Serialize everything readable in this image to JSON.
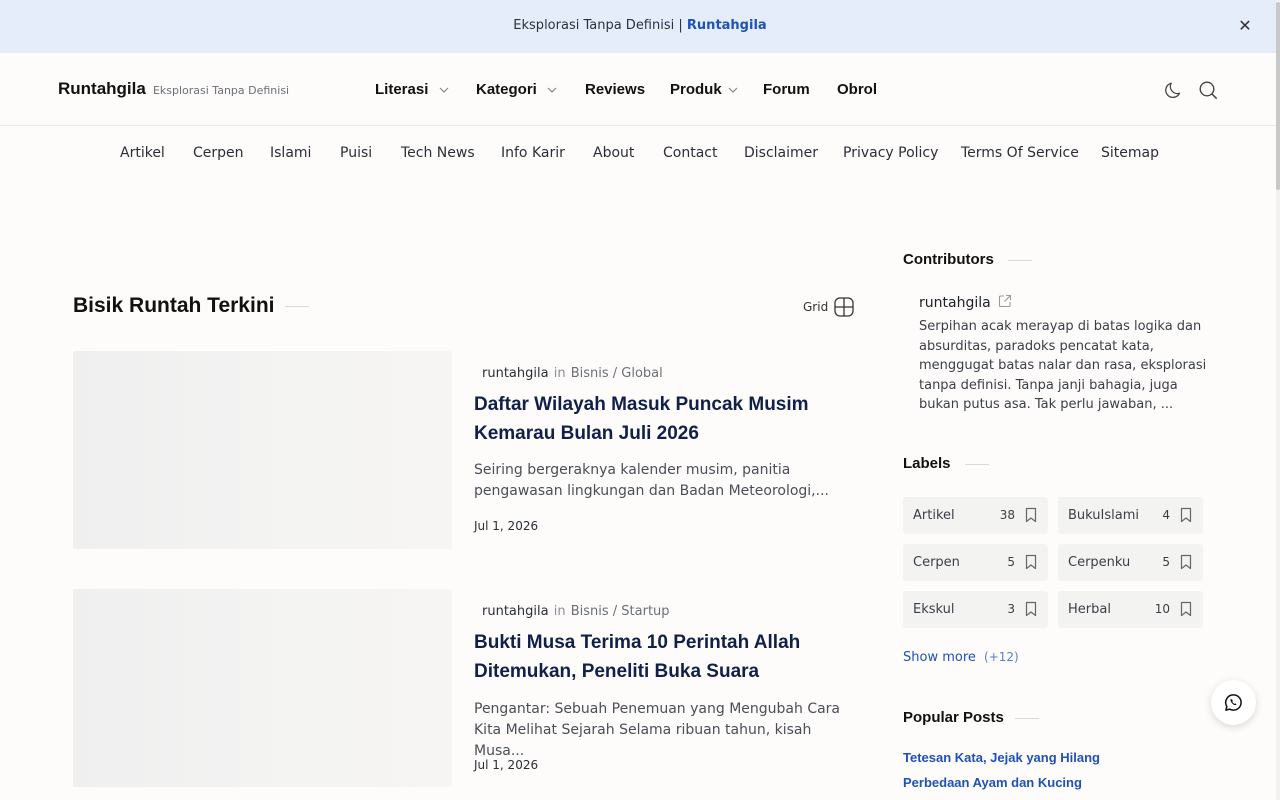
{
  "announcement": {
    "text": "Eksplorasi Tanpa Definisi",
    "separator": "|",
    "link": "Runtahgila",
    "close_icon": "close-icon"
  },
  "header": {
    "brand_name": "Runtahgila",
    "brand_tagline": "Eksplorasi Tanpa Definisi",
    "nav": [
      {
        "label": "Literasi",
        "has_dropdown": true
      },
      {
        "label": "Kategori",
        "has_dropdown": true
      },
      {
        "label": "Reviews",
        "has_dropdown": false
      },
      {
        "label": "Produk",
        "has_dropdown": true
      },
      {
        "label": "Forum",
        "has_dropdown": false
      },
      {
        "label": "Obrol",
        "has_dropdown": false
      }
    ],
    "icons": [
      "moon-icon",
      "search-icon"
    ]
  },
  "subnav": [
    "Artikel",
    "Cerpen",
    "Islami",
    "Puisi",
    "Tech News",
    "Info Karir",
    "About",
    "Contact",
    "Disclaimer",
    "Privacy Policy",
    "Terms Of Service",
    "Sitemap"
  ],
  "main": {
    "section_title": "Bisik Runtah Terkini",
    "view_toggle": "Grid",
    "posts": [
      {
        "author": "runtahgila",
        "in": "in",
        "category": "Bisnis / Global",
        "title": "Daftar Wilayah Masuk Puncak Musim Kemarau Bulan Juli 2026",
        "excerpt": "Seiring bergeraknya kalender musim, panitia pengawasan lingkungan dan Badan Meteorologi,...",
        "date": "Jul 1, 2026"
      },
      {
        "author": "runtahgila",
        "in": "in",
        "category": "Bisnis / Startup",
        "title": "Bukti Musa Terima 10 Perintah Allah Ditemukan, Peneliti Buka Suara",
        "excerpt": "Pengantar: Sebuah Penemuan yang Mengubah Cara Kita Melihat Sejarah Selama ribuan tahun, kisah Musa...",
        "date": "Jul 1, 2026"
      }
    ]
  },
  "sidebar": {
    "contributors_title": "Contributors",
    "contributor_name": "runtahgila",
    "contributor_bio": "Serpihan acak merayap di batas logika dan absurditas, paradoks pencatat kata, menggugat batas nalar dan rasa, eksplorasi tanpa definisi. Tanpa janji bahagia, juga bukan putus asa. Tak perlu jawaban, ...",
    "labels_title": "Labels",
    "labels": [
      {
        "name": "Artikel",
        "count": "38"
      },
      {
        "name": "BukuIslami",
        "count": "4"
      },
      {
        "name": "Cerpen",
        "count": "5"
      },
      {
        "name": "Cerpenku",
        "count": "5"
      },
      {
        "name": "Ekskul",
        "count": "3"
      },
      {
        "name": "Herbal",
        "count": "10"
      }
    ],
    "show_more": "Show more",
    "show_more_count": "(+12)",
    "popular_title": "Popular Posts",
    "popular": [
      "Tetesan Kata, Jejak yang Hilang",
      "Perbedaan Ayam dan Kucing"
    ]
  },
  "colors": {
    "accent": "#1e52b5",
    "announce_bg": "#e6edfa",
    "page_bg": "#fdfcfa"
  }
}
